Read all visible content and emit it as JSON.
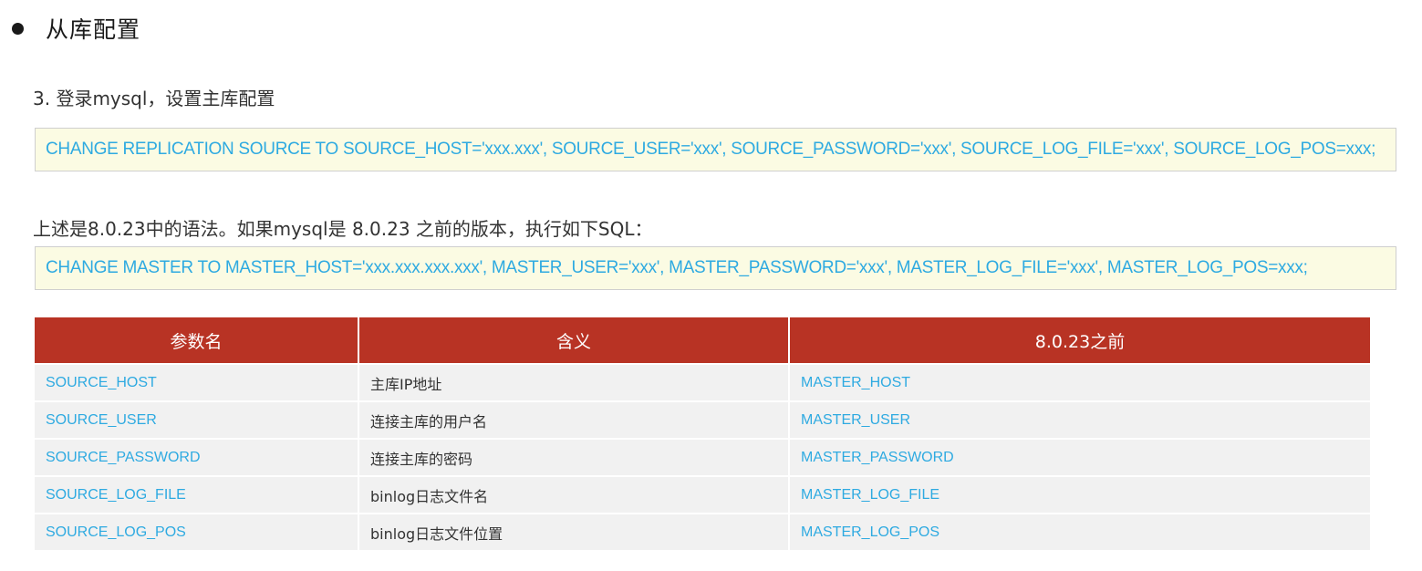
{
  "section": {
    "title": "从库配置"
  },
  "step": {
    "text": "3. 登录mysql，设置主库配置"
  },
  "code_new": "CHANGE REPLICATION SOURCE TO SOURCE_HOST='xxx.xxx', SOURCE_USER='xxx', SOURCE_PASSWORD='xxx', SOURCE_LOG_FILE='xxx', SOURCE_LOG_POS=xxx;",
  "note": "上述是8.0.23中的语法。如果mysql是 8.0.23 之前的版本，执行如下SQL：",
  "code_old": "CHANGE MASTER TO MASTER_HOST='xxx.xxx.xxx.xxx', MASTER_USER='xxx', MASTER_PASSWORD='xxx', MASTER_LOG_FILE='xxx', MASTER_LOG_POS=xxx;",
  "table": {
    "headers": [
      "参数名",
      "含义",
      "8.0.23之前"
    ],
    "rows": [
      {
        "param": "SOURCE_HOST",
        "meaning": "主库IP地址",
        "old": "MASTER_HOST"
      },
      {
        "param": "SOURCE_USER",
        "meaning": "连接主库的用户名",
        "old": "MASTER_USER"
      },
      {
        "param": "SOURCE_PASSWORD",
        "meaning": "连接主库的密码",
        "old": "MASTER_PASSWORD"
      },
      {
        "param": "SOURCE_LOG_FILE",
        "meaning": "binlog日志文件名",
        "old": "MASTER_LOG_FILE"
      },
      {
        "param": "SOURCE_LOG_POS",
        "meaning": "binlog日志文件位置",
        "old": "MASTER_LOG_POS"
      }
    ]
  },
  "colors": {
    "header_bg": "#b83324",
    "code_text": "#2eaae1",
    "code_bg": "#fbfbe3",
    "row_bg": "#f1f1f1"
  }
}
